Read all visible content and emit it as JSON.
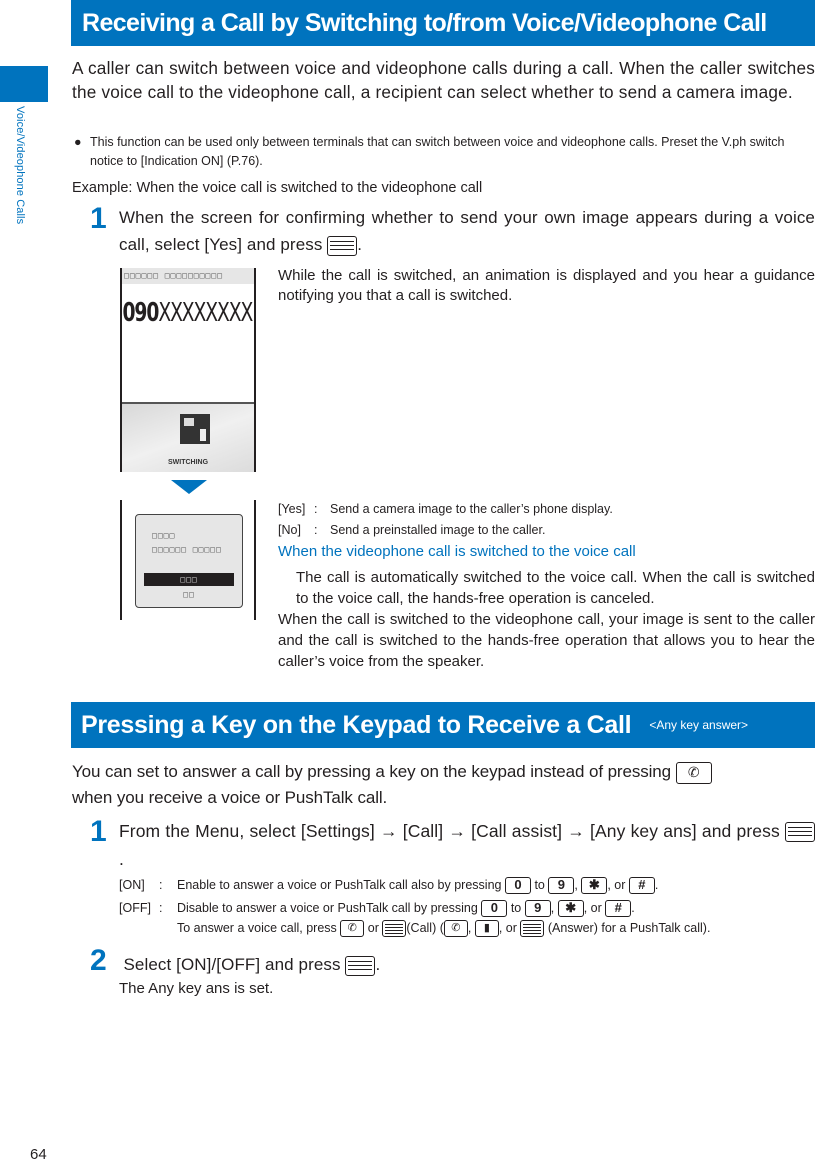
{
  "sidebar": {
    "section_label": "Voice/Videophone Calls"
  },
  "section1": {
    "title": "Receiving a Call by Switching to/from Voice/Videophone Call",
    "intro": "A caller can switch between voice and videophone calls during a call. When the caller switches the voice call to the videophone call, a recipient can select whether to send a camera image.",
    "bullet": "This function can be used only between terminals that can switch between voice and videophone calls. Preset the V.ph switch notice to [Indication ON] (P.76).",
    "example": "Example: When the voice call is switched to the videophone call",
    "step1": {
      "number": "1",
      "text": "When the screen for confirming whether to send your own image appears during a voice call, select [Yes] and press",
      "key_icon": "enter-key-icon",
      "end": "."
    },
    "screen1": {
      "status_bar": "□□□□□□ □□□□□□□□□□",
      "number_prefix": "090",
      "number_rest": "XXXXXXXX",
      "animation_label": "SWITCHING"
    },
    "screen1_desc": "While the call is switched, an animation is displayed and you hear a guidance notifying you that a call is switched.",
    "screen2": {
      "line1": "□□□□",
      "line2": "□□□□□□ □□□□□",
      "selected": "□□□",
      "option2": "□□"
    },
    "options": [
      {
        "key": "[Yes]",
        "colon": ":",
        "desc": "Send a camera image to the caller’s phone display."
      },
      {
        "key": "[No]",
        "colon": ":",
        "desc": "Send a preinstalled image to the caller."
      }
    ],
    "sub_heading": "When the videophone call is switched to the voice call",
    "sub_text": "The call is automatically switched to the voice call. When the call is switched to the voice call, the hands-free operation is canceled.",
    "closing": "When the call is switched to the videophone call, your image is sent to the caller and the call is switched to the hands-free operation that allows you to hear the caller’s voice from the speaker."
  },
  "section2": {
    "title": "Pressing a Key on the Keypad to Receive a Call",
    "subtitle": "<Any key answer>",
    "intro_a": "You can set to answer a call by pressing a key on the keypad instead of pressing",
    "intro_b": "when you receive a voice or PushTalk call.",
    "step1": {
      "number": "1",
      "text": "From the Menu, select [Settings] → [Call] → [Call assist] → [Any key ans] and press",
      "end": "."
    },
    "options": {
      "on": {
        "key": "[ON]",
        "colon": ":",
        "text_a": "Enable to answer a voice or PushTalk call also by pressing",
        "to": "to",
        "comma": ",",
        "or": ", or",
        "end": "."
      },
      "off": {
        "key": "[OFF]",
        "colon": ":",
        "text_a": "Disable to answer a voice or PushTalk call by pressing",
        "to": "to",
        "comma": ",",
        "or": ", or",
        "end": ".",
        "line2_a": "To answer a voice call, press",
        "line2_or": "or",
        "line2_call": "(Call) (",
        "line2_comma": ",",
        "line2_or2": ", or",
        "line2_end": "(Answer) for a PushTalk call)."
      }
    },
    "keys": {
      "zero": "0",
      "nine": "9",
      "star": "✱",
      "hash": "#",
      "phone": "✆",
      "ptt": "🎙"
    },
    "step2": {
      "number": "2",
      "text": "Select [ON]/[OFF] and press",
      "end": "."
    },
    "result": "The Any key ans is set."
  },
  "footer": {
    "page_number": "64"
  },
  "colors": {
    "accent": "#0073be",
    "text": "#231f20"
  }
}
